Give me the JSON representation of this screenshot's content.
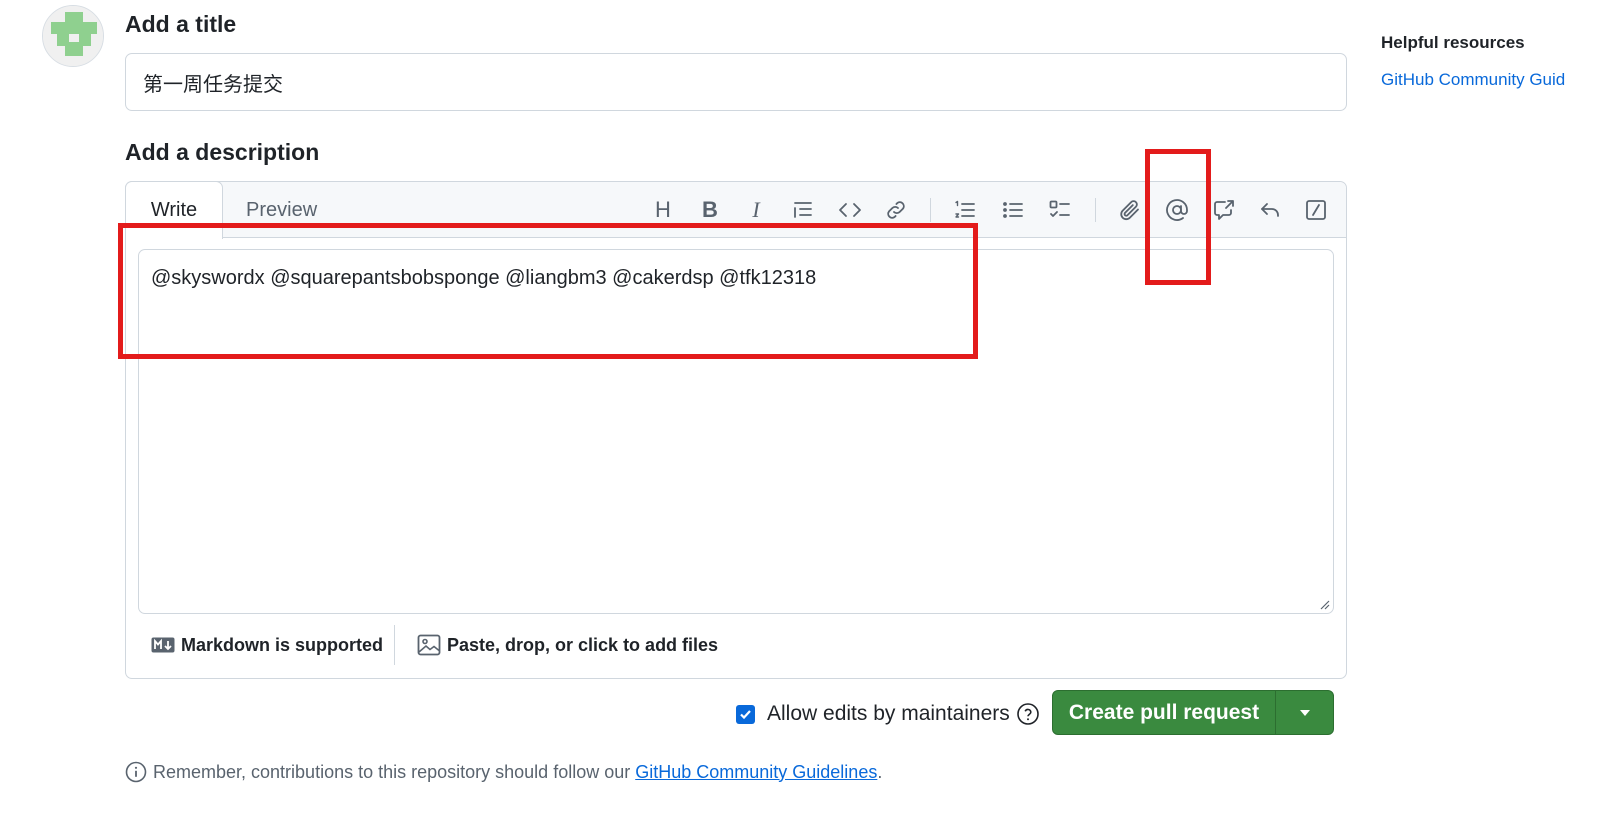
{
  "title_section": {
    "label": "Add a title",
    "value": "第一周任务提交"
  },
  "description_section": {
    "label": "Add a description",
    "tabs": [
      {
        "label": "Write",
        "active": true
      },
      {
        "label": "Preview",
        "active": false
      }
    ],
    "toolbar_icons": [
      "heading-icon",
      "bold-icon",
      "italic-icon",
      "quote-icon",
      "code-icon",
      "link-icon",
      "ordered-list-icon",
      "unordered-list-icon",
      "task-list-icon",
      "attach-icon",
      "mention-icon",
      "cross-reference-icon",
      "reply-icon",
      "slash-commands-icon"
    ],
    "heading_glyph": "H",
    "bold_glyph": "B",
    "italic_glyph": "I",
    "body": "@skyswordx @squarepantsbobsponge @liangbm3 @cakerdsp @tfk12318",
    "markdown_hint": "Markdown is supported",
    "attach_hint": "Paste, drop, or click to add files"
  },
  "actions": {
    "allow_edits_label": "Allow edits by maintainers",
    "allow_edits_checked": true,
    "create_button_label": "Create pull request"
  },
  "remember": {
    "text": "Remember, contributions to this repository should follow our",
    "link_text": "GitHub Community Guidelines",
    "suffix": "."
  },
  "sidebar": {
    "title": "Helpful resources",
    "link": "GitHub Community Guid"
  },
  "colors": {
    "accent_blue": "#0969da",
    "create_green": "#3a8a3f",
    "annotation_red": "#e31b1b",
    "avatar_green": "#8fd08f"
  }
}
